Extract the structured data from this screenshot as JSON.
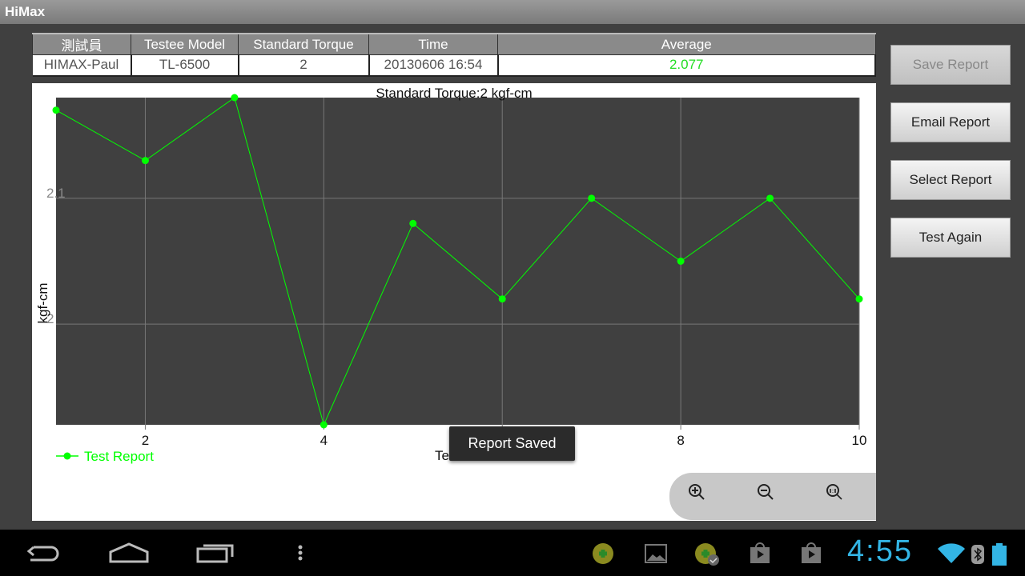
{
  "app": {
    "title": "HiMax"
  },
  "info_table": {
    "headers": [
      "測試員",
      "Testee Model",
      "Standard Torque",
      "Time",
      "Average"
    ],
    "values": [
      "HIMAX-Paul",
      "TL-6500",
      "2",
      "20130606 16:54",
      "2.077"
    ]
  },
  "buttons": {
    "save": "Save Report",
    "email": "Email Report",
    "select": "Select Report",
    "again": "Test Again"
  },
  "toast": "Report Saved",
  "status": {
    "clock": "4:55"
  },
  "chart_data": {
    "type": "line",
    "title": "Standard Torque:2 kgf-cm",
    "xlabel": "Te",
    "ylabel": "kgf-cm",
    "x": [
      1,
      2,
      3,
      4,
      5,
      6,
      7,
      8,
      9,
      10
    ],
    "series": [
      {
        "name": "Test Report",
        "values": [
          2.17,
          2.13,
          2.18,
          1.92,
          2.08,
          2.02,
          2.1,
          2.05,
          2.1,
          2.02
        ],
        "color": "#00ff00"
      }
    ],
    "xlim": [
      1,
      10
    ],
    "ylim": [
      1.92,
      2.18
    ],
    "xticks": [
      2,
      4,
      6,
      8,
      10
    ],
    "xtick_labels": [
      "2",
      "4",
      "",
      "8",
      "10"
    ],
    "yticks": [
      2.0,
      2.1
    ],
    "ytick_labels": [
      "2",
      "2.1"
    ],
    "grid": true,
    "legend": "bottom-left",
    "plot_bg": "#404040"
  }
}
